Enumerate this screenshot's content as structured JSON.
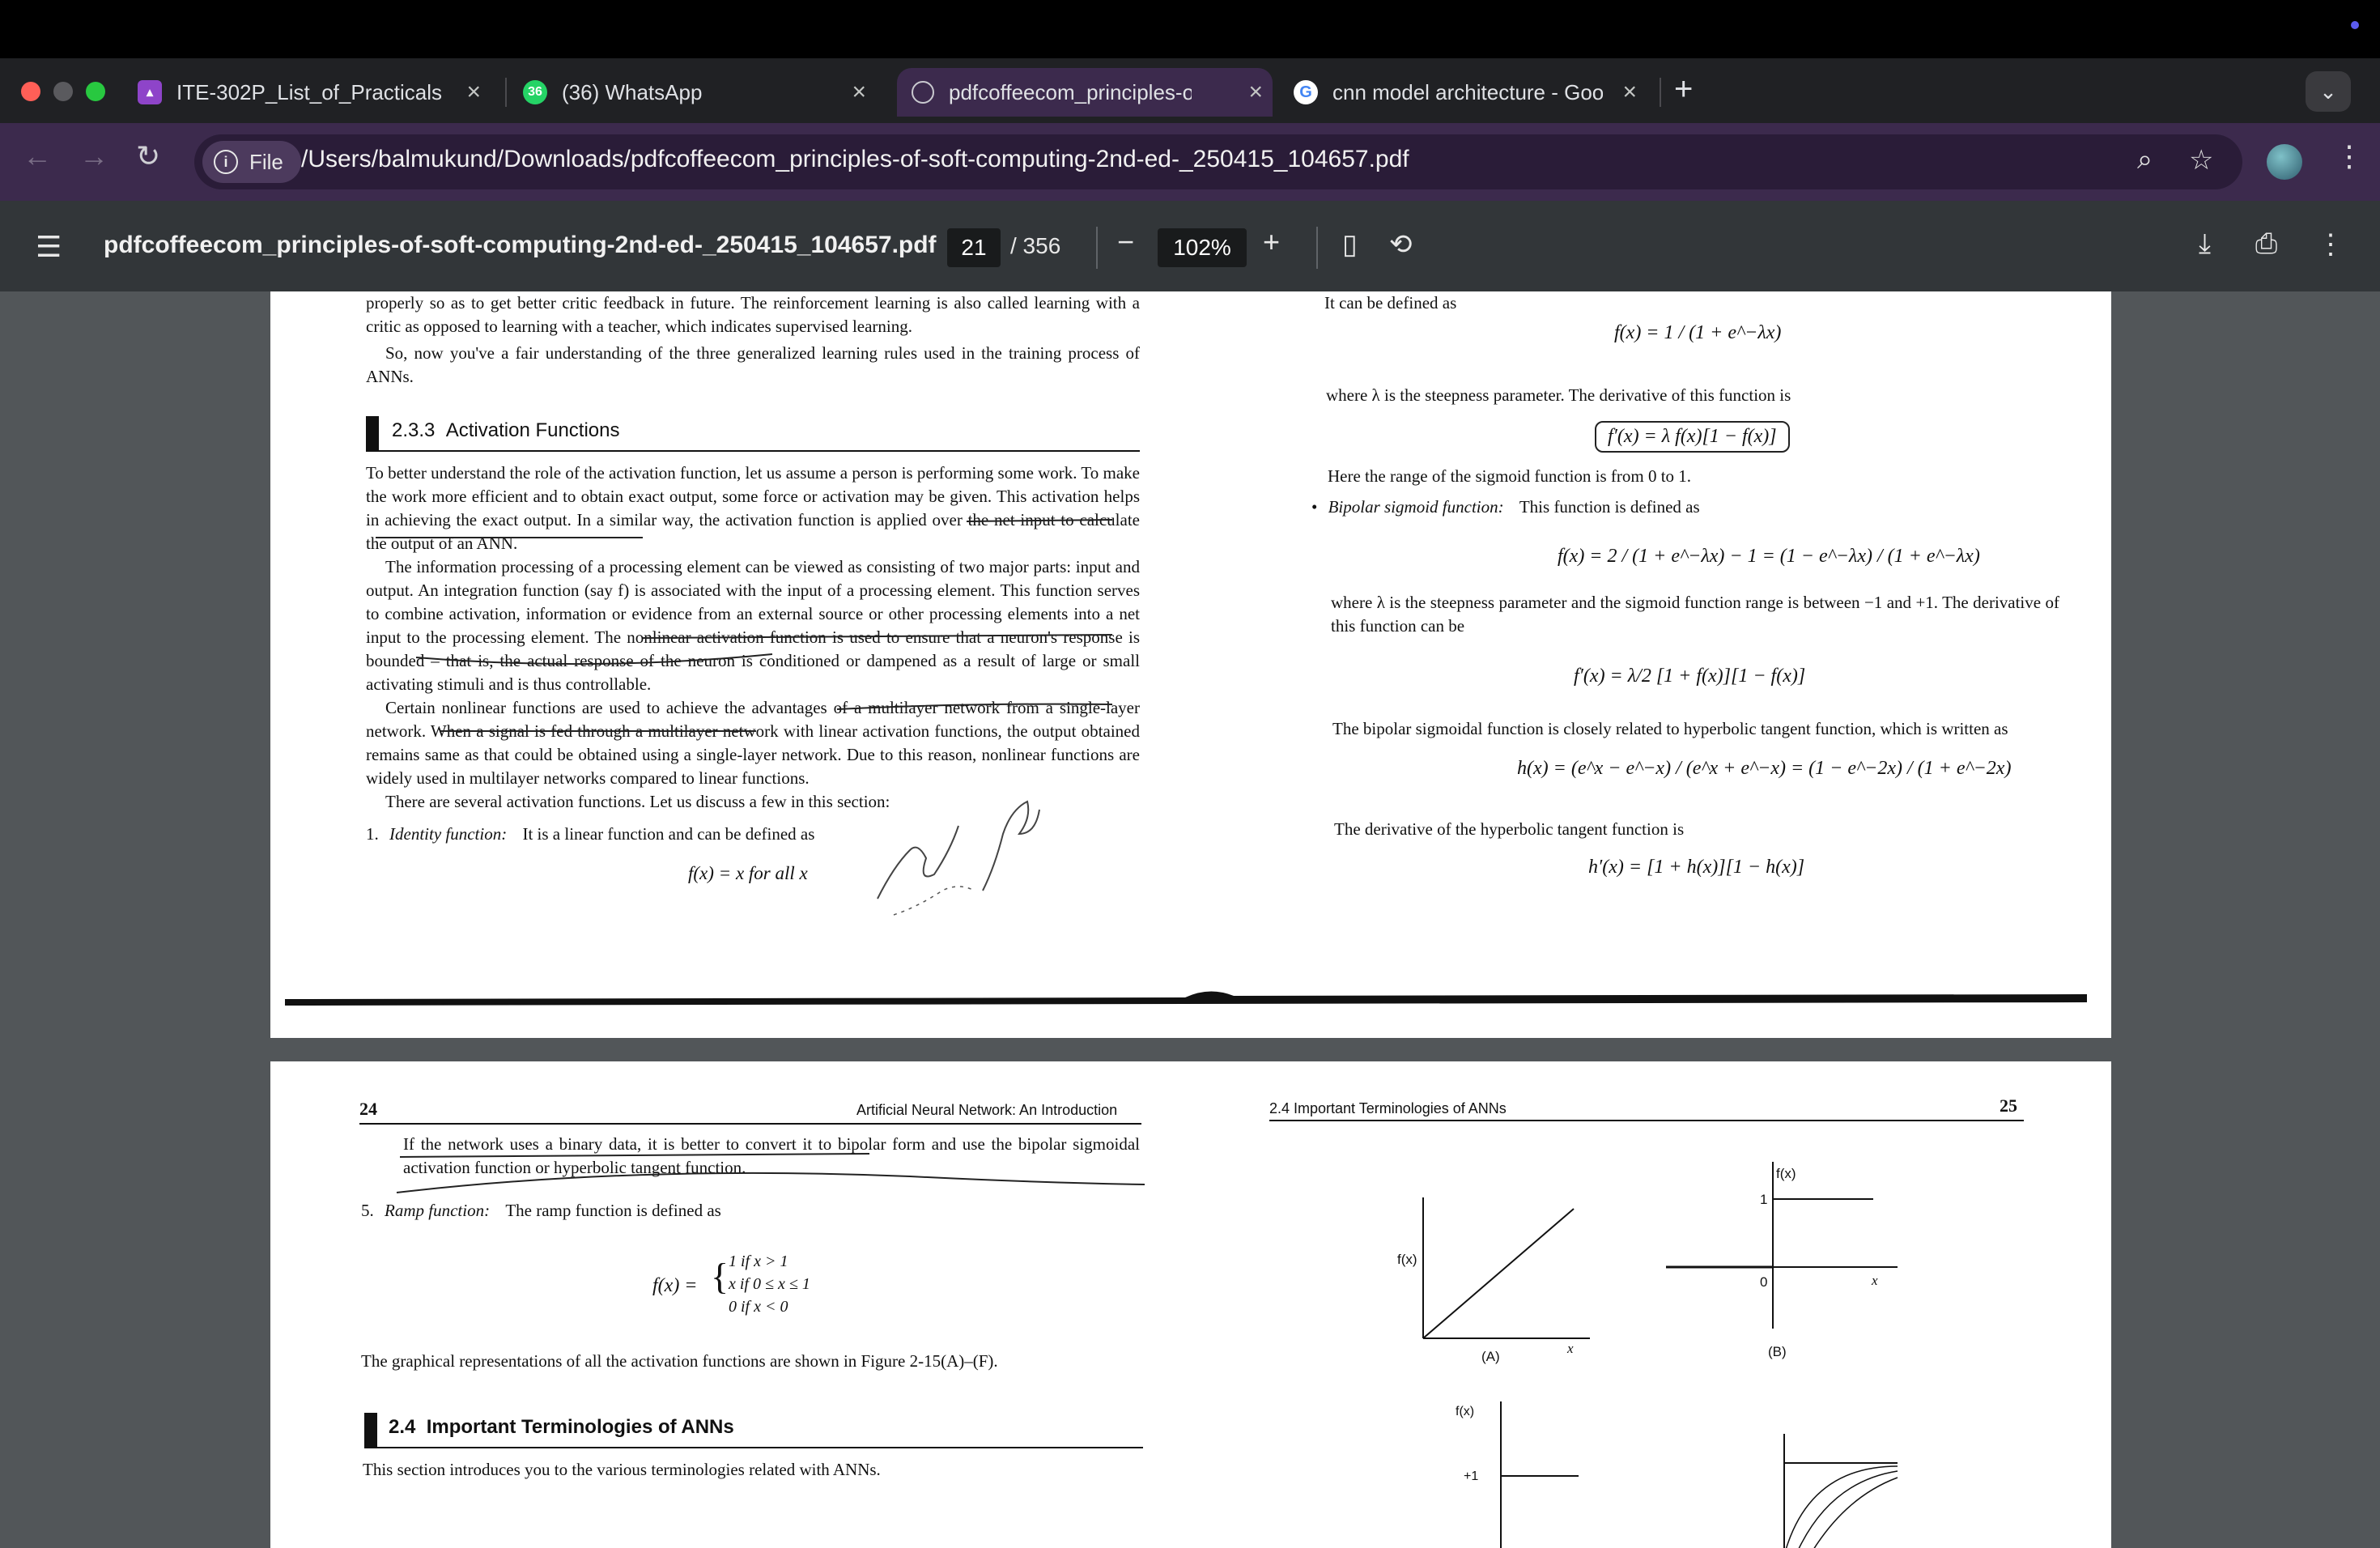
{
  "browser": {
    "tabs": [
      {
        "title": "ITE-302P_List_of_Practicals",
        "favicon": "classroom-icon"
      },
      {
        "title": "(36) WhatsApp",
        "favicon": "whatsapp-icon",
        "badge": "36"
      },
      {
        "title": "pdfcoffeecom_principles-of-s",
        "favicon": "globe-icon",
        "active": true
      },
      {
        "title": "cnn model architecture - Goo",
        "favicon": "google-icon"
      }
    ],
    "chip_label": "File",
    "url": "/Users/balmukund/Downloads/pdfcoffeecom_principles-of-soft-computing-2nd-ed-_250415_104657.pdf"
  },
  "viewer": {
    "filename": "pdfcoffeecom_principles-of-soft-computing-2nd-ed-_250415_104657.pdf",
    "current_page": "21",
    "total_pages": "/ 356",
    "zoom": "102%"
  },
  "page_top": {
    "left": {
      "p0": "properly so as to get better critic feedback in future. The reinforcement learning is also called learning with a critic as opposed to learning with a teacher, which indicates supervised learning.",
      "p1": "So, now you've a fair understanding of the three generalized learning rules used in the training process of ANNs.",
      "section_number": "2.3.3",
      "section_title": "Activation Functions",
      "p2": "To better understand the role of the activation function, let us assume a person is performing some work. To make the work more efficient and to obtain exact output, some force or activation may be given. This activation helps in achieving the exact output. In a similar way, the activation function is applied over the net input to calculate the output of an ANN.",
      "p3": "The information processing of a processing element can be viewed as consisting of two major parts: input and output. An integration function (say f) is associated with the input of a processing element. This function serves to combine activation, information or evidence from an external source or other processing elements into a net input to the processing element. The nonlinear activation function is used to ensure that a neuron's response is bounded – that is, the actual response of the neuron is conditioned or dampened as a result of large or small activating stimuli and is thus controllable.",
      "p4": "Certain nonlinear functions are used to achieve the advantages of a multilayer network from a single-layer network. When a signal is fed through a multilayer network with linear activation functions, the output obtained remains same as that could be obtained using a single-layer network. Due to this reason, nonlinear functions are widely used in multilayer networks compared to linear functions.",
      "p5": "There are several activation functions. Let us discuss a few in this section:",
      "item1_num": "1.",
      "item1_name": "Identity function:",
      "item1_text": "It is a linear function and can be defined as",
      "item1_eq": "f(x) = x  for all x"
    },
    "right": {
      "r0": "It can be defined as",
      "eq_sigmoid": "f(x) = 1 / (1 + e^−λx)",
      "r1": "where λ is the steepness parameter. The derivative of this function is",
      "eq_sig_deriv": "f′(x) = λ f(x)[1 − f(x)]",
      "r2": "Here the range of the sigmoid function is from 0 to 1.",
      "bullet_name": "Bipolar sigmoid function:",
      "bullet_text": "This function is defined as",
      "eq_bipolar": "f(x) = 2 / (1 + e^−λx) − 1 = (1 − e^−λx) / (1 + e^−λx)",
      "r3": "where λ is the steepness parameter and the sigmoid function range is between −1 and +1. The derivative of this function can be",
      "eq_bip_deriv": "f′(x) = λ/2 [1 + f(x)][1 − f(x)]",
      "r4": "The bipolar sigmoidal function is closely related to hyperbolic tangent function, which is written as",
      "eq_tanh": "h(x) = (e^x − e^−x) / (e^x + e^−x) = (1 − e^−2x) / (1 + e^−2x)",
      "r5": "The derivative of the hyperbolic tangent function is",
      "eq_tanh_deriv": "h′(x) = [1 + h(x)][1 − h(x)]"
    }
  },
  "page_bottom": {
    "left": {
      "page_num": "24",
      "running_head": "Artificial Neural Network: An Introduction",
      "p0": "If the network uses a binary data, it is better to convert it to bipolar form and use the bipolar sigmoidal activation function or hyperbolic tangent function.",
      "item5_num": "5.",
      "item5_name": "Ramp function:",
      "item5_text": "The ramp function is defined as",
      "ramp_lhs": "f(x) =",
      "ramp_case1": "1   if x > 1",
      "ramp_case2": "x   if 0 ≤ x ≤ 1",
      "ramp_case3": "0   if x < 0",
      "p1": "The graphical representations of all the activation functions are shown in Figure 2-15(A)–(F).",
      "section_number": "2.4",
      "section_title": "Important Terminologies of ANNs",
      "p2": "This section introduces you to the various terminologies related with ANNs."
    },
    "right": {
      "running_head": "2.4 Important Terminologies of ANNs",
      "page_num": "25",
      "figA_ylabel": "f(x)",
      "figA_xlabel": "x",
      "figA_caption": "(A)",
      "figB_ylabel": "f(x)",
      "figB_one": "1",
      "figB_zero": "0",
      "figB_xlabel": "x",
      "figB_caption": "(B)",
      "figC_ylabel": "f(x)",
      "figC_plus1": "+1"
    }
  }
}
